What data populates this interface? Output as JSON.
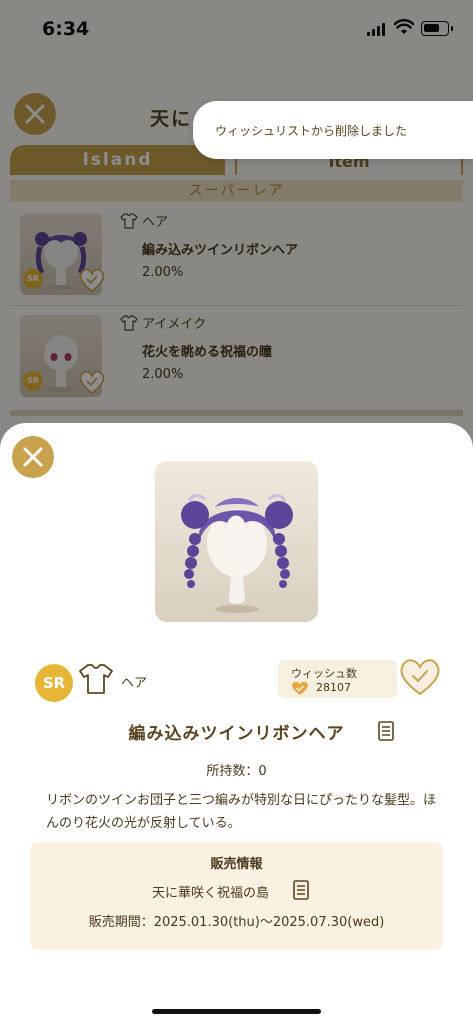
{
  "status_bar": {
    "time": "6:34"
  },
  "background": {
    "title": "天に",
    "tabs": {
      "island": "Island",
      "item": "Item"
    },
    "rarity_header": "スーパーレア",
    "items": [
      {
        "category": "ヘア",
        "name": "編み込みツインリボンヘア",
        "rate": "2.00%",
        "rarity": "SR"
      },
      {
        "category": "アイメイク",
        "name": "花火を眺める祝福の瞳",
        "rate": "2.00%",
        "rarity": "SR"
      }
    ]
  },
  "toast": {
    "message": "ウィッシュリストから削除しました"
  },
  "detail": {
    "rarity": "SR",
    "category": "ヘア",
    "wish_label": "ウィッシュ数",
    "wish_count": "28107",
    "item_name": "編み込みツインリボンヘア",
    "owned": "所持数：0",
    "description": "リボンのツインお団子と三つ編みが特別な日にぴったりな髪型。ほんのり花火の光が反射している。",
    "sale": {
      "title": "販売情報",
      "island": "天に華咲く祝福の島",
      "period": "販売期間：2025.01.30(thu)〜2025.07.30(wed)"
    }
  },
  "colors": {
    "gold": "#c9a24d",
    "sr_badge": "#e8b636",
    "heart": "#e8a640"
  },
  "icons": {
    "close": "close-icon",
    "shirt": "shirt-icon",
    "heart": "heart-icon",
    "document": "document-icon"
  }
}
